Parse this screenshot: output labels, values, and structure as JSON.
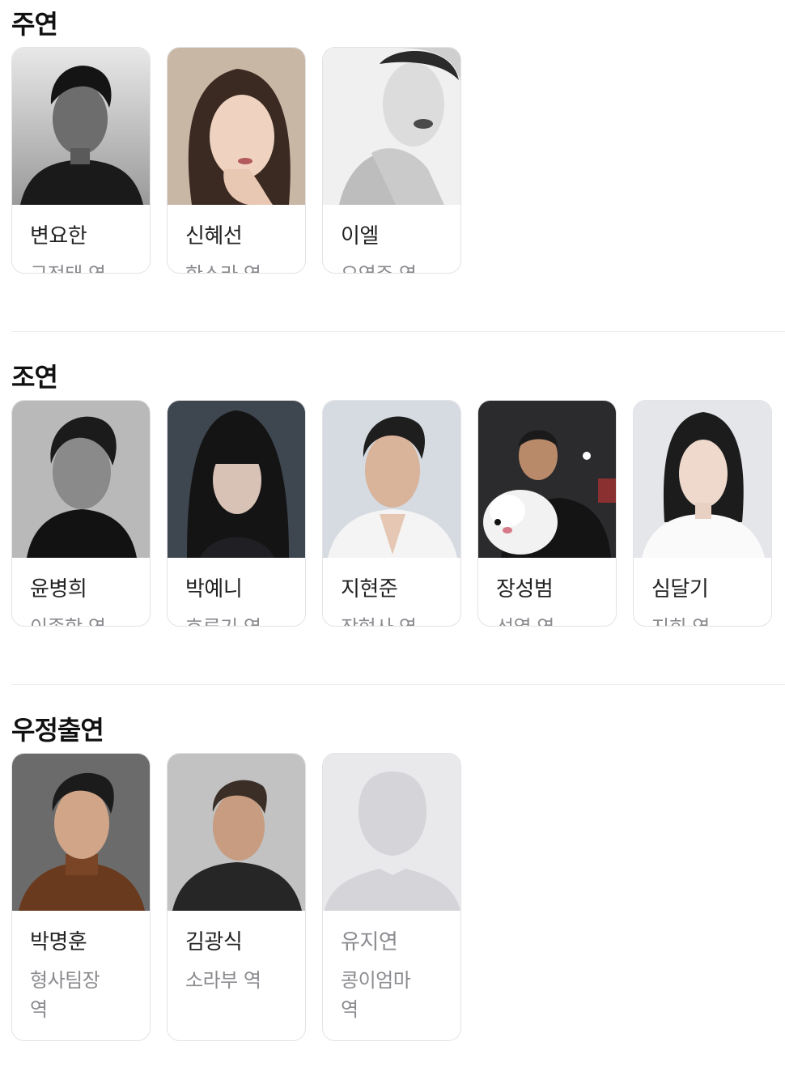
{
  "sections": [
    {
      "title": "주연",
      "cast": [
        {
          "name": "변요한",
          "role": "구정태 역",
          "photo": "actor-photo"
        },
        {
          "name": "신혜선",
          "role": "한소라 역",
          "photo": "actor-photo"
        },
        {
          "name": "이엘",
          "role": "오영주 역",
          "photo": "actor-photo"
        }
      ]
    },
    {
      "title": "조연",
      "cast": [
        {
          "name": "윤병희",
          "role": "이종학 역",
          "photo": "actor-photo"
        },
        {
          "name": "박예니",
          "role": "호루기 역",
          "photo": "actor-photo"
        },
        {
          "name": "지현준",
          "role": "장형사 역",
          "photo": "actor-photo"
        },
        {
          "name": "장성범",
          "role": "성열 역",
          "photo": "actor-photo"
        },
        {
          "name": "심달기",
          "role": "지희 역",
          "photo": "actor-photo"
        }
      ]
    },
    {
      "title": "우정출연",
      "cast": [
        {
          "name": "박명훈",
          "role": "형사팀장 역",
          "photo": "actor-photo"
        },
        {
          "name": "김광식",
          "role": "소라부 역",
          "photo": "actor-photo"
        },
        {
          "name": "유지연",
          "role": "콩이엄마 역",
          "photo": "placeholder-silhouette"
        }
      ]
    }
  ],
  "colors": {
    "title": "#111111",
    "name": "#222222",
    "role": "#8b8b90",
    "card_border": "#e3e3e6",
    "divider": "#ececee",
    "placeholder_bg": "#e9e9ec",
    "placeholder_figure": "#d5d5d9"
  }
}
